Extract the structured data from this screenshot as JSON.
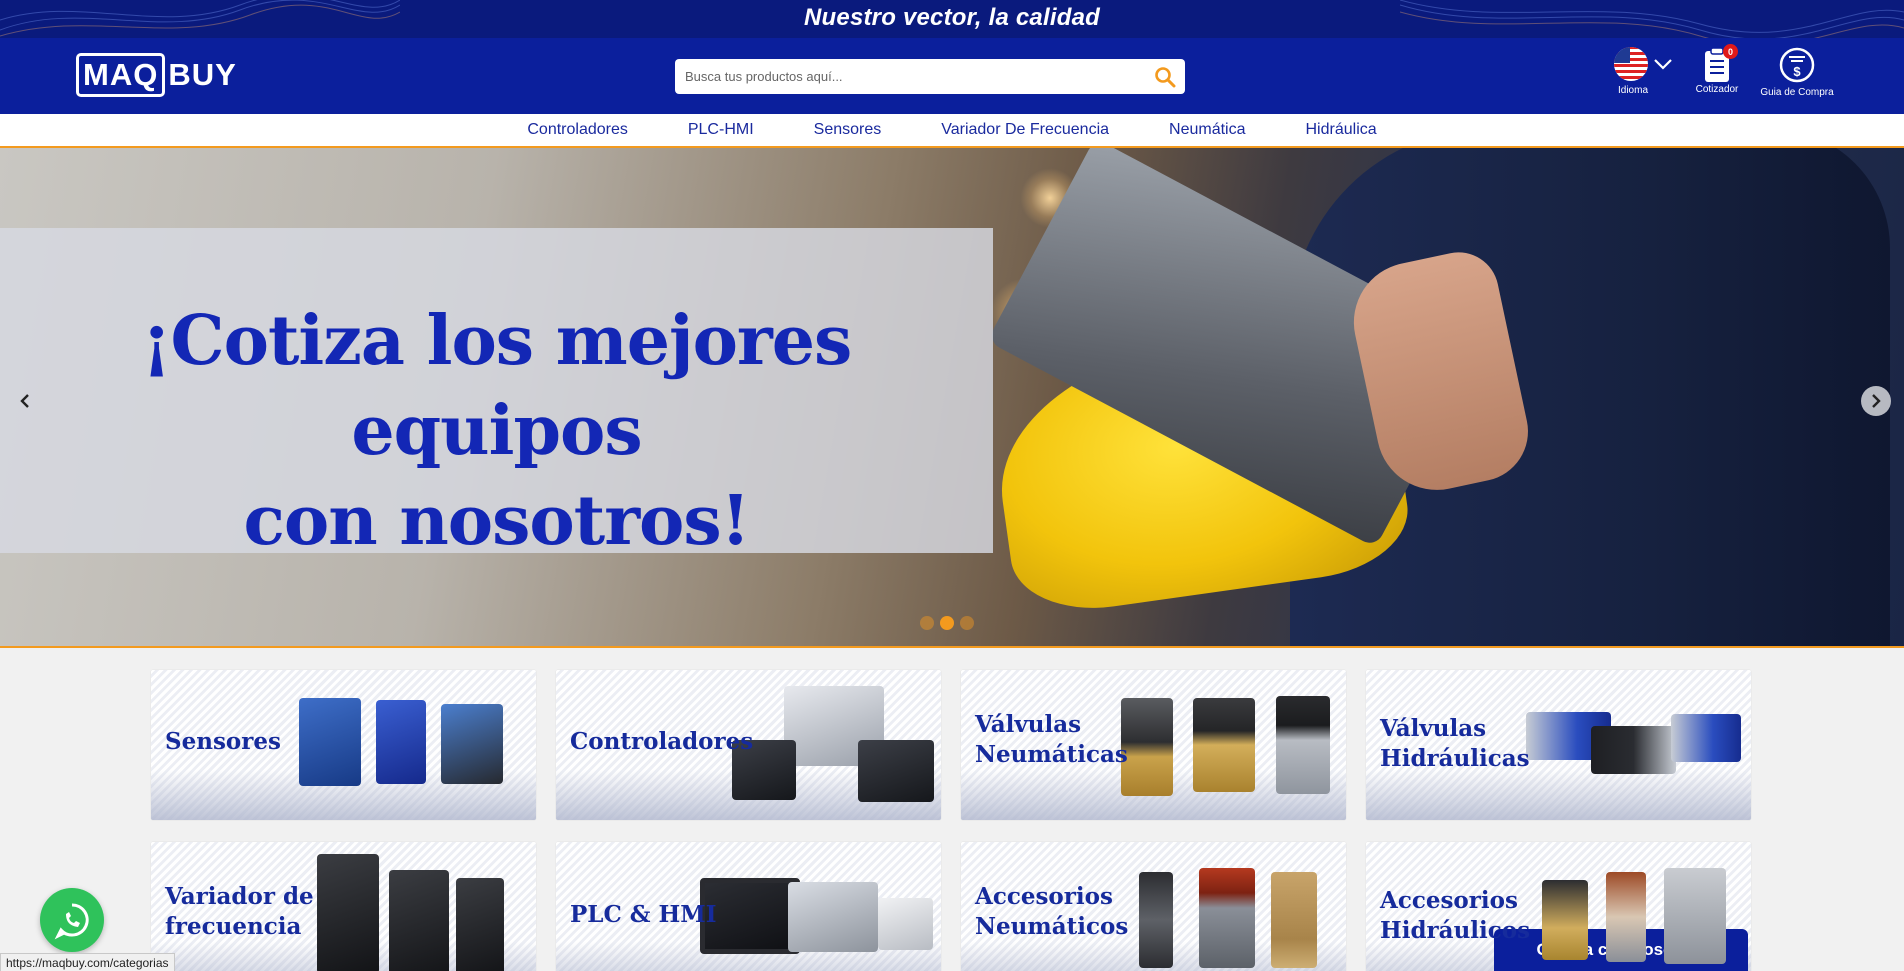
{
  "banner": {
    "tagline": "Nuestro vector, la calidad"
  },
  "header": {
    "logo_box": "MAQ",
    "logo_rest": "BUY",
    "search_placeholder": "Busca tus productos aquí...",
    "idioma_label": "Idioma",
    "cotizador_label": "Cotizador",
    "cart_count": "0",
    "guia_label": "Guia de Compra"
  },
  "nav": {
    "items": [
      "Controladores",
      "PLC-HMI",
      "Sensores",
      "Variador De Frecuencia",
      "Neumática",
      "Hidráulica"
    ]
  },
  "hero": {
    "line1": "¡Cotiza los mejores equipos",
    "line2": "con nosotros!",
    "slide_count": 3,
    "active_slide": 2
  },
  "categories": [
    {
      "title": "Sensores"
    },
    {
      "title": "Controladores"
    },
    {
      "title": "Válvulas\nNeumáticas"
    },
    {
      "title": "Válvulas\nHidráulicas"
    },
    {
      "title": "Variador de\nfrecuencia"
    },
    {
      "title": "PLC & HMI"
    },
    {
      "title": "Accesorios\nNeumáticos"
    },
    {
      "title": "Accesorios\nHidráulicos"
    }
  ],
  "chat": {
    "label": "Chatea con nosotros"
  },
  "status_bar": {
    "url": "https://maqbuy.com/categorias"
  },
  "colors": {
    "brand_blue": "#0b1f9c",
    "accent_orange": "#f39a1e",
    "whatsapp_green": "#2fc25b"
  }
}
